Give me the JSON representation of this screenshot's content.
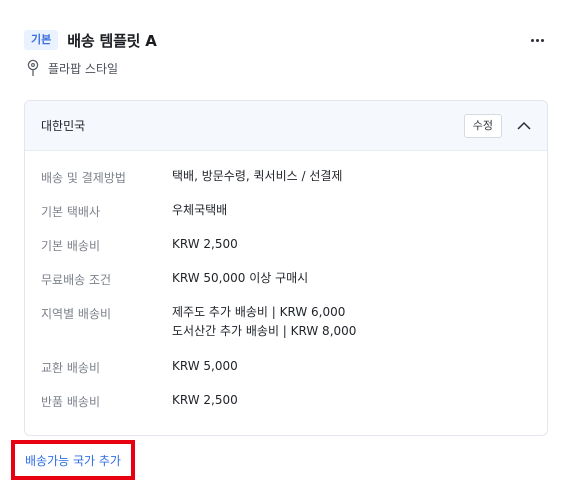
{
  "header": {
    "badge": "기본",
    "title": "배송 템플릿 A",
    "more_icon": "more-horizontal-icon"
  },
  "style": {
    "icon": "location-pin-icon",
    "label": "플라팝 스타일"
  },
  "card": {
    "country": "대한민국",
    "edit_label": "수정",
    "collapse_icon": "chevron-up-icon",
    "rows": [
      {
        "label": "배송 및 결제방법",
        "value": "택배, 방문수령, 퀵서비스 / 선결제"
      },
      {
        "label": "기본 택배사",
        "value": "우체국택배"
      },
      {
        "label": "기본 배송비",
        "value": "KRW 2,500"
      },
      {
        "label": "무료배송 조건",
        "value": "KRW 50,000 이상 구매시"
      },
      {
        "label": "지역별 배송비",
        "value": "제주도 추가 배송비 | KRW 6,000",
        "value2": "도서산간 추가 배송비 | KRW 8,000"
      },
      {
        "label": "교환 배송비",
        "value": "KRW 5,000"
      },
      {
        "label": "반품 배송비",
        "value": "KRW 2,500"
      }
    ]
  },
  "add_country_label": "배송가능 국가 추가",
  "colors": {
    "badge_bg": "#eaf1ff",
    "badge_text": "#3b6fe0",
    "link": "#2f6fe4",
    "highlight_border": "#e60012",
    "card_header_bg": "#f5f8fc"
  }
}
